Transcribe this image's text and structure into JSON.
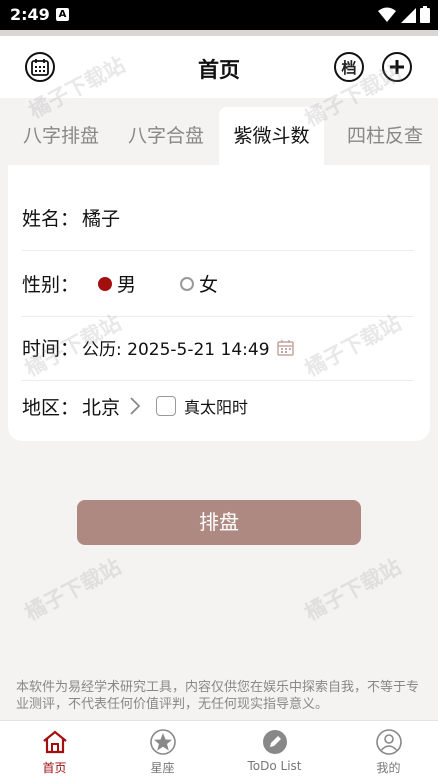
{
  "status_bar": {
    "time": "2:49",
    "notification_letter": "A"
  },
  "header": {
    "title": "首页",
    "archive_label": "档"
  },
  "tabs": [
    {
      "label": "八字排盘",
      "active": false
    },
    {
      "label": "八字合盘",
      "active": false
    },
    {
      "label": "紫微斗数",
      "active": true
    },
    {
      "label": "四柱反查",
      "active": false
    }
  ],
  "form": {
    "name_label": "姓名：",
    "name_value": "橘子",
    "gender_label": "性别：",
    "gender_male": "男",
    "gender_female": "女",
    "gender_selected": "男",
    "time_label": "时间：",
    "time_value": "公历: 2025-5-21 14:49",
    "region_label": "地区：",
    "region_value": "北京",
    "solar_time_label": "真太阳时",
    "solar_time_checked": false
  },
  "submit_label": "排盘",
  "disclaimer": "本软件为易经学术研究工具，内容仅供您在娱乐中探索自我，不等于专业测评，不代表任何价值评判，无任何现实指导意义。",
  "bottom_nav": [
    {
      "label": "首页",
      "icon": "home-icon",
      "active": true
    },
    {
      "label": "星座",
      "icon": "star-icon",
      "active": false
    },
    {
      "label": "ToDo List",
      "icon": "pencil-icon",
      "active": false
    },
    {
      "label": "我的",
      "icon": "user-icon",
      "active": false
    }
  ],
  "watermark": "橘子下载站",
  "colors": {
    "accent": "#a30f0f",
    "button": "#ae8982",
    "background": "#f5f3f2"
  }
}
